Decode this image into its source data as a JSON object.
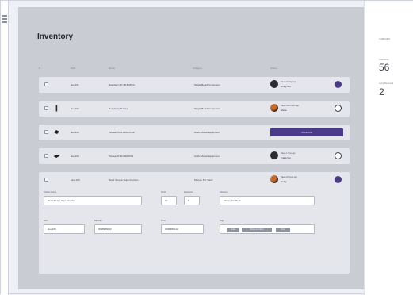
{
  "inventory": {
    "title": "Inventory",
    "columns": [
      "#",
      "SKU",
      "Name",
      "Category",
      "Owner"
    ],
    "rows": [
      {
        "sku": "sku-101",
        "name": "Raspberry Pi 4B 8GB Kit",
        "category": "Single Board Computers",
        "owner_line1": "Taken 18 days ago",
        "owner_line2": "Emily Wu",
        "action": "purple-dot"
      },
      {
        "sku": "sku-102",
        "name": "Raspberry Pi Zero",
        "category": "Single Board Computers",
        "owner_line1": "Taken 3/29 hours ago",
        "owner_line2": "Steve",
        "action": "ring"
      },
      {
        "sku": "sku-103",
        "name": "Pioneer CDJ-2000NXS2",
        "category": "Audio Visual Equipment",
        "availability": "Available"
      },
      {
        "sku": "sku-104",
        "name": "Pioneer DJM-900NXS2",
        "category": "Audio Visual Equipment",
        "owner_line1": "Taken 1 hour ago",
        "owner_line2": "Frank Mo",
        "action": "ring"
      },
      {
        "sku": "sku-105",
        "name": "Twist Shape Tape Dumbo",
        "category": "Money For Rent",
        "owner_line1": "Taken 18 hours ago",
        "owner_line2": "Emily",
        "action": "purple-dot"
      }
    ],
    "edit": {
      "name_label": "Display Name",
      "name_value": "Twist Shape Tape Dumbo",
      "stock_label": "Stock",
      "stock_value": "10",
      "reserved_label": "Reserved",
      "reserved_value": "5",
      "category_label": "Category",
      "category_value": "Money For Rent",
      "sku_label": "SKU",
      "sku_value": "sku-105",
      "barcode_label": "Barcode",
      "barcode_value": "0098989012",
      "price_label": "Price",
      "price_value": "0098989012",
      "tags_label": "Tags",
      "tags": [
        "Audio",
        "Money For Rent",
        "Tools"
      ],
      "date_value": "0098989012"
    }
  },
  "sidebar": {
    "header": "OVERVIEW",
    "total_items_label": "Total Items",
    "total_items_value": "56",
    "items_reserved_label": "Items Reserved",
    "items_reserved_value": "2"
  },
  "colors": {
    "accent": "#4b3a8a",
    "canvas": "#c9ccd2",
    "row": "#e4e6eb"
  }
}
